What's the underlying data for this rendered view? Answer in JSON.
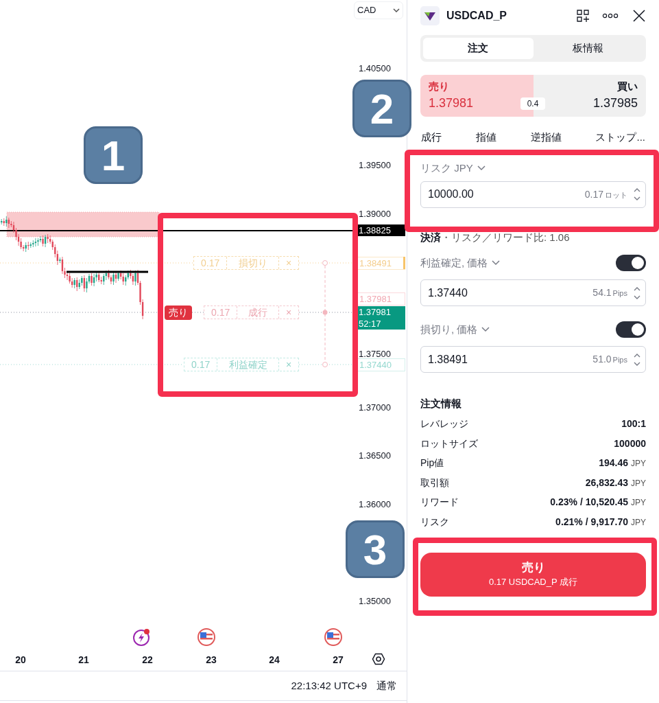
{
  "chart": {
    "currency_select": "CAD",
    "price_axis": [
      "1.40500",
      "1.39500",
      "1.39000",
      "1.37500",
      "1.37000",
      "1.36500",
      "1.36000",
      "1.35000"
    ],
    "price_tags": [
      {
        "kind": "line",
        "text": "1.38825"
      },
      {
        "kind": "stop",
        "text": "1.38491"
      },
      {
        "kind": "entry",
        "text": "1.37981"
      },
      {
        "kind": "current",
        "text": "1.37981",
        "countdown": "52:17"
      },
      {
        "kind": "target",
        "text": "1.37440"
      }
    ],
    "order_lines": [
      {
        "kind": "stop",
        "qty": "0.17",
        "label": "損切り",
        "close": "×"
      },
      {
        "kind": "entry",
        "side": "売り",
        "qty": "0.17",
        "label": "成行",
        "close": "×"
      },
      {
        "kind": "target",
        "qty": "0.17",
        "label": "利益確定",
        "close": "×"
      }
    ],
    "dates": [
      "20",
      "21",
      "22",
      "23",
      "24",
      "27"
    ]
  },
  "status_bar": {
    "time": "22:13:42 UTC+9",
    "session": "通常"
  },
  "panel": {
    "symbol": "USDCAD_P",
    "tabs": [
      {
        "label": "注文",
        "selected": true
      },
      {
        "label": "板情報",
        "selected": false
      }
    ],
    "quote": {
      "sell": {
        "label": "売り",
        "price": "1.37981",
        "selected": true
      },
      "buy": {
        "label": "買い",
        "price": "1.37985",
        "selected": false
      },
      "spread": "0.4"
    },
    "order_types": [
      "成行",
      "指値",
      "逆指値",
      "ストップ..."
    ],
    "risk": {
      "label": "リスク JPY",
      "value": "10000.00",
      "lots": "0.17",
      "unit": "ロット"
    },
    "exit_title": "**決済**・リスク／リワード比: 1.06",
    "exits": [
      {
        "label": "利益確定, 価格",
        "on": true,
        "value": "1.37440",
        "pips": "54.1",
        "unit": "Pips"
      },
      {
        "label": "損切り, 価格",
        "on": true,
        "value": "1.38491",
        "pips": "51.0",
        "unit": "Pips"
      }
    ],
    "info": {
      "title": "注文情報",
      "rows": [
        {
          "label": "レバレッジ",
          "value": "100:1"
        },
        {
          "label": "ロットサイズ",
          "value": "100000"
        },
        {
          "label": "Pip値",
          "value": "194.46",
          "unit": "JPY"
        },
        {
          "label": "取引額",
          "value": "26,832.43",
          "unit": "JPY"
        },
        {
          "label": "リワード",
          "value": "0.23% / 10,520.45",
          "unit": "JPY"
        },
        {
          "label": "リスク",
          "value": "0.21% / 9,917.70",
          "unit": "JPY"
        }
      ]
    },
    "submit": {
      "title": "売り",
      "detail": "0.17 USDCAD_P 成行"
    }
  },
  "callouts": [
    {
      "text": "1"
    },
    {
      "text": "2"
    },
    {
      "text": "3"
    }
  ]
}
